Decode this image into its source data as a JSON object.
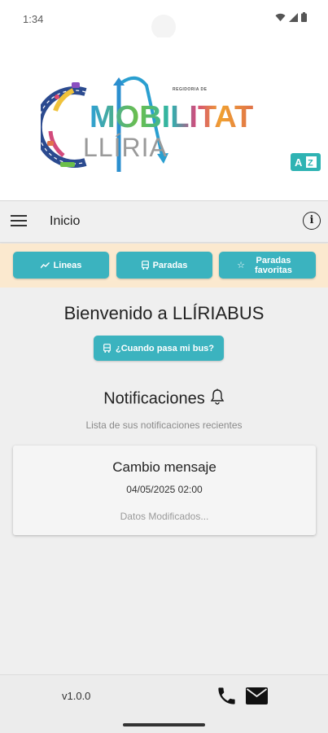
{
  "status_bar": {
    "time": "1:34"
  },
  "header": {
    "logo": {
      "small_caption": "REGIDORIA DE",
      "word_mobilitat": "MOBILITAT",
      "word_lliria": "LLÍRIA"
    },
    "az_button_label": "AZ"
  },
  "toolbar": {
    "title": "Inicio"
  },
  "quick_actions": [
    {
      "label": "Lineas",
      "icon": "chart-line-icon"
    },
    {
      "label": "Paradas",
      "icon": "bus-stop-icon"
    },
    {
      "label": "Paradas favoritas",
      "icon": "star-icon"
    }
  ],
  "main": {
    "welcome": "Bienvenido a LLÍRIABUS",
    "cuando_button": "¿Cuando pasa mi bus?",
    "notifications_title": "Notificaciones",
    "notifications_subtitle": "Lista de sus notificaciones recientes",
    "notifications": [
      {
        "title": "Cambio mensaje",
        "date": "04/05/2025 02:00",
        "body": "Datos Modificados..."
      }
    ]
  },
  "footer": {
    "version": "v1.0.0"
  },
  "colors": {
    "accent": "#3bb3bf",
    "quickbar_bg": "#fbe9cf"
  }
}
